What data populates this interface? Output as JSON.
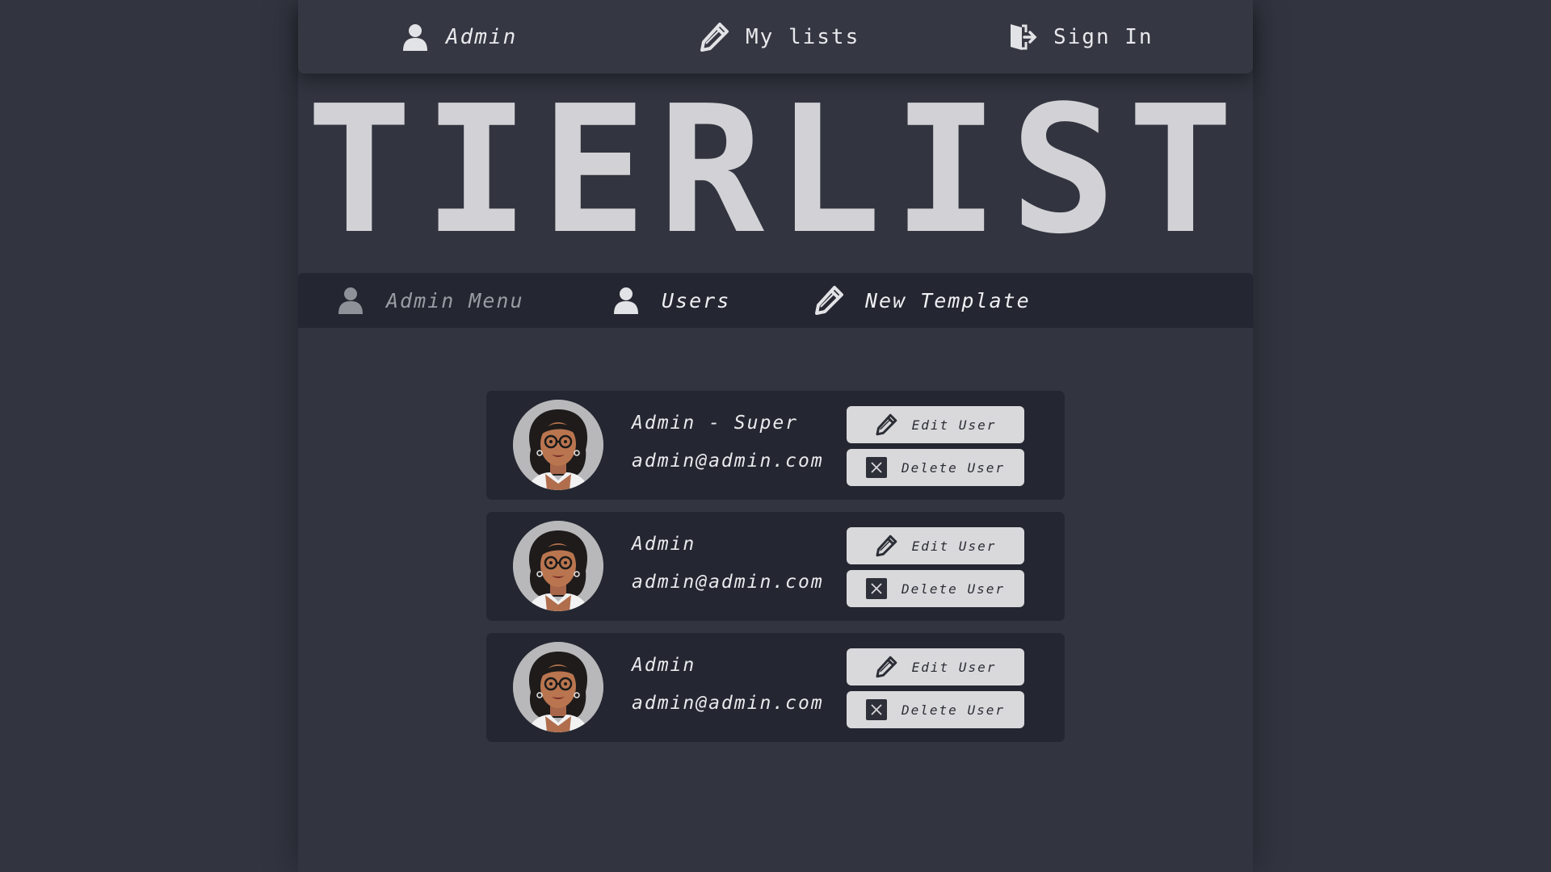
{
  "topnav": {
    "items": [
      {
        "label": "Admin",
        "icon": "user-icon"
      },
      {
        "label": "My lists",
        "icon": "pencil-icon"
      },
      {
        "label": "Sign In",
        "icon": "sign-in-icon"
      }
    ]
  },
  "logo": {
    "text": "TIERLIST"
  },
  "subnav": {
    "items": [
      {
        "label": "Admin Menu",
        "icon": "user-icon"
      },
      {
        "label": "Users",
        "icon": "user-icon"
      },
      {
        "label": "New Template",
        "icon": "pencil-icon"
      }
    ]
  },
  "users": [
    {
      "name": "Admin - Super",
      "email": "admin@admin.com",
      "edit_label": "Edit User",
      "delete_label": "Delete User"
    },
    {
      "name": "Admin",
      "email": "admin@admin.com",
      "edit_label": "Edit User",
      "delete_label": "Delete User"
    },
    {
      "name": "Admin",
      "email": "admin@admin.com",
      "edit_label": "Edit User",
      "delete_label": "Delete User"
    }
  ],
  "colors": {
    "background": "#323540",
    "panel": "#242731",
    "button": "#d9d9dc",
    "logo": "#d2d2d6"
  }
}
